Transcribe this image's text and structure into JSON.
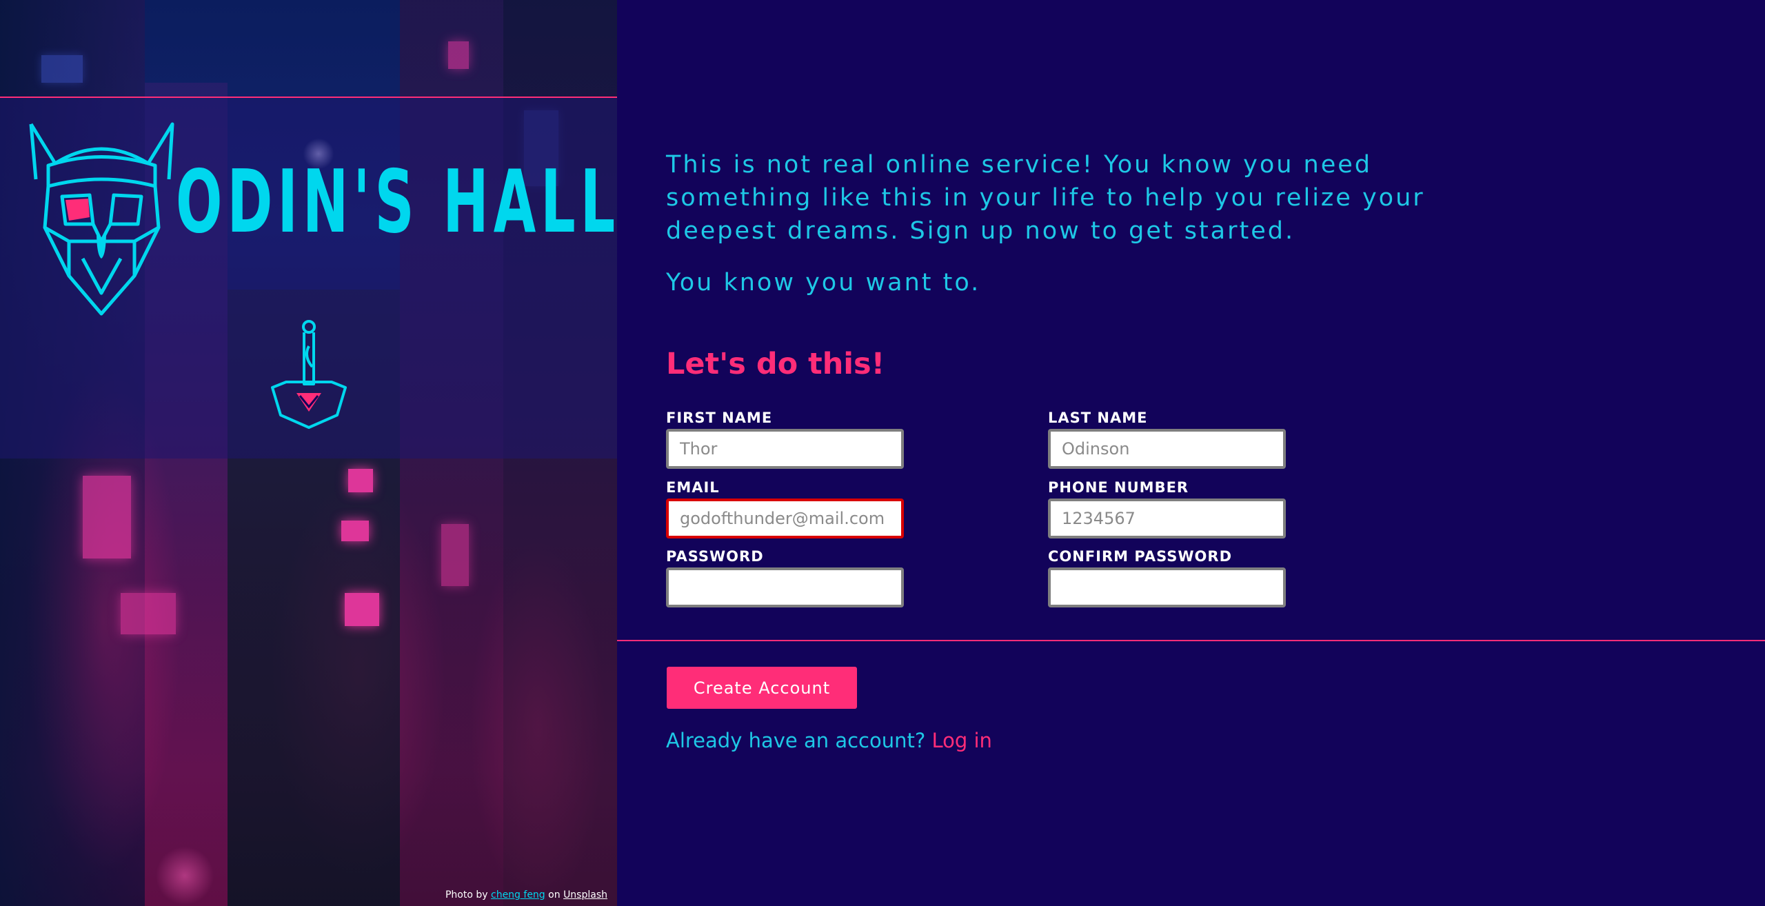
{
  "brand": {
    "name": "ODIN'S HALL",
    "logo_icon": "viking-helmet-icon",
    "emblem_icon": "mjolnir-hammer-icon"
  },
  "photo_credit": {
    "prefix": "Photo by",
    "author": "cheng feng",
    "middle": "on",
    "site": "Unsplash"
  },
  "intro": {
    "paragraph": "This is not real online service! You know you need something like this in your life to help you relize your deepest dreams. Sign up now to get started.",
    "tagline": "You know you want to."
  },
  "form": {
    "heading": "Let's do this!",
    "fields": {
      "first_name": {
        "label": "FIRST NAME",
        "placeholder": "Thor",
        "value": ""
      },
      "last_name": {
        "label": "LAST NAME",
        "placeholder": "Odinson",
        "value": ""
      },
      "email": {
        "label": "EMAIL",
        "placeholder": "godofthunder@mail.com",
        "value": "",
        "state": "invalid"
      },
      "phone": {
        "label": "PHONE NUMBER",
        "placeholder": "1234567",
        "value": ""
      },
      "password": {
        "label": "PASSWORD",
        "placeholder": "",
        "value": ""
      },
      "confirm_password": {
        "label": "CONFIRM PASSWORD",
        "placeholder": "",
        "value": ""
      }
    },
    "submit_label": "Create Account",
    "login_prompt": "Already have an account?",
    "login_link": "Log in"
  },
  "colors": {
    "background": "#12035a",
    "accent_pink": "#ff2d78",
    "accent_cyan": "#1ec8e6",
    "invalid_border": "#d90000"
  }
}
